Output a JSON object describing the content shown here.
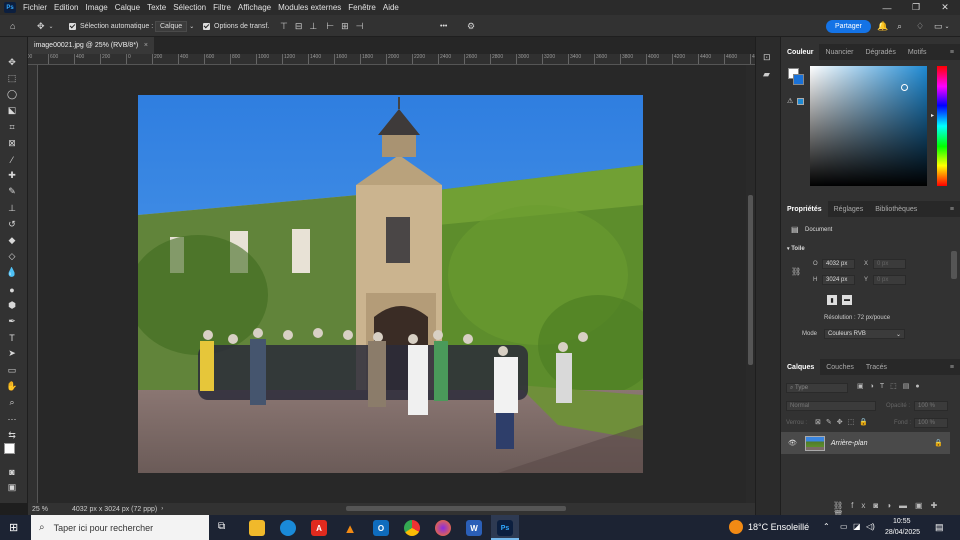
{
  "menubar": {
    "logo": "Ps",
    "items": [
      "Fichier",
      "Edition",
      "Image",
      "Calque",
      "Texte",
      "Sélection",
      "Filtre",
      "Affichage",
      "Modules externes",
      "Fenêtre",
      "Aide"
    ],
    "window_controls": [
      "—",
      "❐",
      "✕"
    ]
  },
  "options": {
    "auto_select_label": "Sélection automatique :",
    "auto_select_value": "Calque",
    "transform_label": "Options de transf.",
    "more": "•••",
    "share_label": "Partager"
  },
  "document": {
    "tab_title": "image00021.jpg @ 25% (RVB/8*)",
    "close": "×",
    "zoom": "25 %",
    "info": "4032 px x 3024 px (72 ppp)"
  },
  "ruler": {
    "ticks": [
      "800",
      "600",
      "400",
      "200",
      "0",
      "200",
      "400",
      "600",
      "800",
      "1000",
      "1200",
      "1400",
      "1600",
      "1800",
      "2000",
      "2200",
      "2400",
      "2600",
      "2800",
      "3000",
      "3200",
      "3400",
      "3600",
      "3800",
      "4000",
      "4200",
      "4400",
      "4600",
      "4800"
    ]
  },
  "color_panel": {
    "tabs": [
      "Couleur",
      "Nuancier",
      "Dégradés",
      "Motifs"
    ]
  },
  "properties_panel": {
    "tabs": [
      "Propriétés",
      "Réglages",
      "Bibliothèques"
    ],
    "doc_label": "Document",
    "section": "Toile",
    "w_label": "O",
    "w_value": "4032 px",
    "h_label": "H",
    "h_value": "3024 px",
    "x_label": "X",
    "x_value": "0 px",
    "y_label": "Y",
    "y_value": "0 px",
    "resolution": "Résolution : 72 px/pouce",
    "mode_label": "Mode",
    "mode_value": "Couleurs RVB"
  },
  "layers_panel": {
    "tabs": [
      "Calques",
      "Couches",
      "Tracés"
    ],
    "filter_placeholder": "Type",
    "blend_mode": "Normal",
    "opacity_label": "Opacité :",
    "opacity_value": "100 %",
    "lock_label": "Verrou :",
    "fill_label": "Fond :",
    "fill_value": "100 %",
    "layer_name": "Arrière-plan"
  },
  "taskbar": {
    "search_placeholder": "Taper ici pour rechercher",
    "apps": [
      "Files",
      "Edge",
      "Acrobat",
      "VLC",
      "Outlook",
      "Chrome",
      "Firefox",
      "Word",
      "Ps"
    ],
    "weather": "18°C Ensoleillé",
    "time": "10:55",
    "date": "28/04/2025"
  }
}
